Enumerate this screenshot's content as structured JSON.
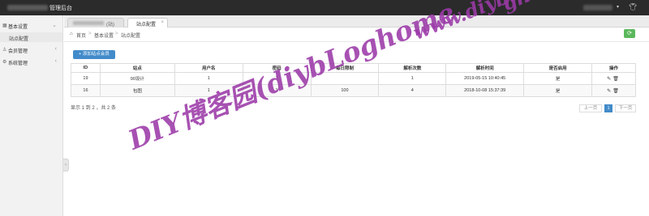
{
  "header": {
    "title": "管理后台",
    "caret": "▾",
    "shirt_icon": "tshirt-icon"
  },
  "sidebar": {
    "items": [
      {
        "label": "基本设置",
        "icon": "grid-icon",
        "open": true,
        "children": [
          {
            "label": "站点配置"
          }
        ]
      },
      {
        "label": "会员管理",
        "icon": "user-icon"
      },
      {
        "label": "系统管理",
        "icon": "gear-icon"
      }
    ]
  },
  "tabs": [
    {
      "label": "",
      "suffix": "(站)"
    },
    {
      "label": "站点配置",
      "close": "×"
    }
  ],
  "breadcrumb": [
    "首页",
    "基本设置",
    "站点配置"
  ],
  "toolbar": {
    "add_label": "+ 添加站点会员",
    "refresh_icon": "refresh-icon"
  },
  "table": {
    "columns": [
      "ID",
      "站点",
      "用户名",
      "密码",
      "每日限制",
      "解析次数",
      "解析时间",
      "是否启用",
      "操作"
    ],
    "rows": [
      {
        "id": "19",
        "site": "90设计",
        "username": "1",
        "password": "2",
        "daily": "",
        "count": "1",
        "time": "2019-05-15 10:40:45",
        "enabled": "是"
      },
      {
        "id": "16",
        "site": "包图",
        "username": "1",
        "password": "1",
        "daily": "100",
        "count": "4",
        "time": "2018-10-08 15:37:39",
        "enabled": "是"
      }
    ]
  },
  "pagination": {
    "summary": "显示 1 到 2 ，共 2 条",
    "prev": "上一页",
    "current": "1",
    "next": "下一页"
  },
  "watermarks": {
    "main": "DIY博客园(diybLoghome",
    "corner": "www.diyblo",
    "corner2": "ghome.com"
  },
  "colors": {
    "accent": "#428bca",
    "success": "#5cb85c",
    "topbar": "#2b2b2b",
    "watermark": "#9b3aa8"
  }
}
